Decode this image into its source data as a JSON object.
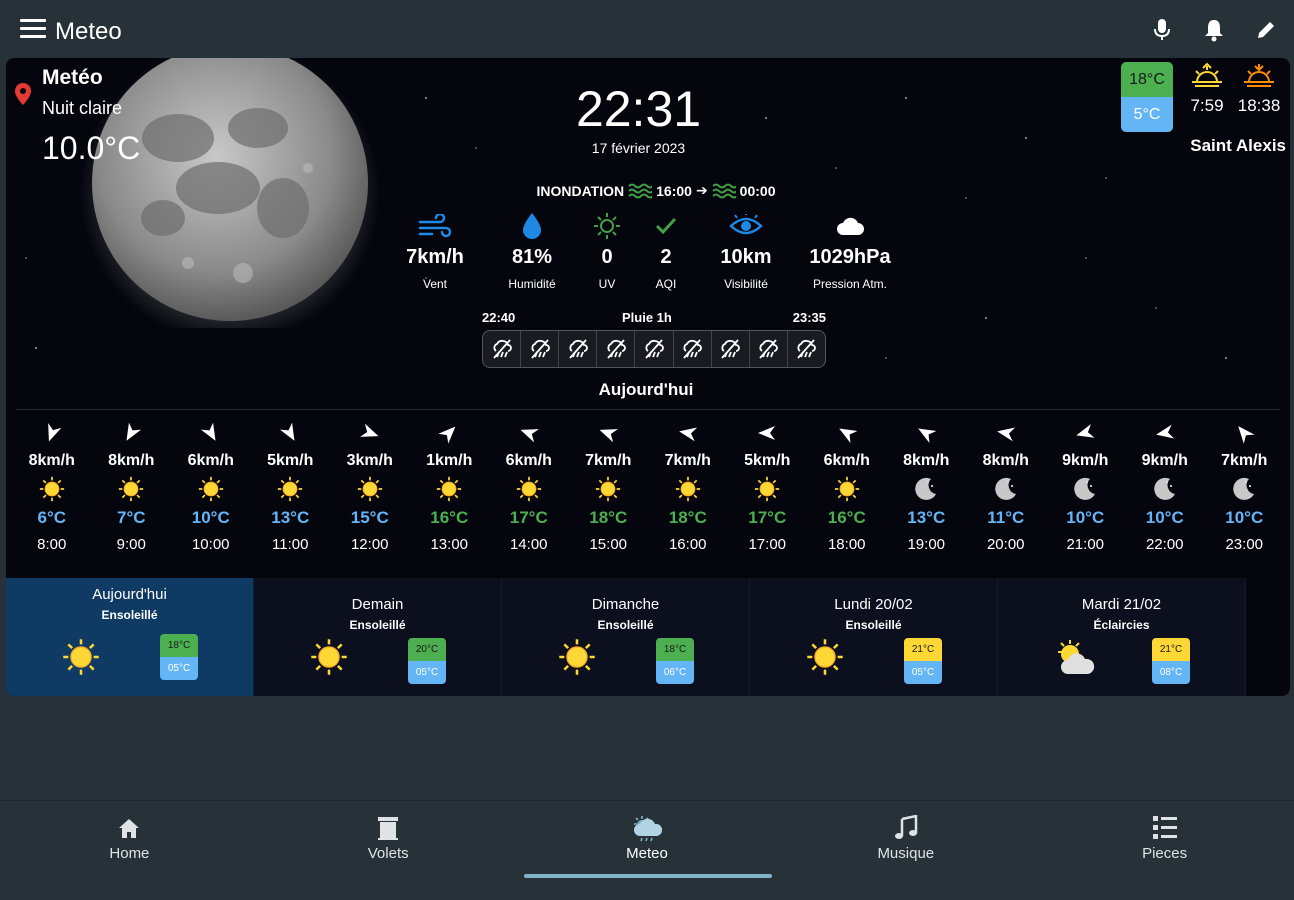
{
  "app": {
    "title": "Meteo"
  },
  "top_actions": [
    "microphone-icon",
    "bell-icon",
    "pencil-icon"
  ],
  "location": {
    "name": "Metéo",
    "condition": "Nuit claire",
    "temperature": "10.0°C",
    "city": "Saint Alexis"
  },
  "clock": {
    "time": "22:31",
    "date": "17 février 2023"
  },
  "alert": {
    "label": "INONDATION",
    "start": "16:00",
    "end": "00:00"
  },
  "metrics": [
    {
      "icon": "wind-icon",
      "value": "7km/h",
      "label": "Vent"
    },
    {
      "icon": "humidity-drop-icon",
      "value": "81%",
      "label": "Humidité"
    },
    {
      "icon": "uv-sun-icon",
      "value": "0",
      "label": "UV"
    },
    {
      "icon": "check-icon",
      "value": "2",
      "label": "AQI"
    },
    {
      "icon": "eye-icon",
      "value": "10km",
      "label": "Visibilité"
    },
    {
      "icon": "cloud-icon",
      "value": "1029hPa",
      "label": "Pression Atm."
    }
  ],
  "rain": {
    "start": "22:40",
    "title": "Pluie 1h",
    "end": "23:35",
    "cells": 9
  },
  "today_label": "Aujourd'hui",
  "today_range": {
    "high": "18°C",
    "low": "5°C"
  },
  "sun": {
    "sunrise": "7:59",
    "sunset": "18:38"
  },
  "colors": {
    "green": "#4caf50",
    "blue": "#64b5f6",
    "yellow": "#fdd835",
    "active_day": "#0f3a63"
  },
  "hourly": [
    {
      "dir": 200,
      "wind": "8km/h",
      "icon": "sun",
      "temp": "6°C",
      "tc": "blue",
      "hour": "8:00"
    },
    {
      "dir": 210,
      "wind": "8km/h",
      "icon": "sun",
      "temp": "7°C",
      "tc": "blue",
      "hour": "9:00"
    },
    {
      "dir": 150,
      "wind": "6km/h",
      "icon": "sun",
      "temp": "10°C",
      "tc": "blue",
      "hour": "10:00"
    },
    {
      "dir": 150,
      "wind": "5km/h",
      "icon": "sun",
      "temp": "13°C",
      "tc": "blue",
      "hour": "11:00"
    },
    {
      "dir": 110,
      "wind": "3km/h",
      "icon": "sun",
      "temp": "15°C",
      "tc": "blue",
      "hour": "12:00"
    },
    {
      "dir": 45,
      "wind": "1km/h",
      "icon": "sun",
      "temp": "16°C",
      "tc": "green",
      "hour": "13:00"
    },
    {
      "dir": 290,
      "wind": "6km/h",
      "icon": "sun",
      "temp": "17°C",
      "tc": "green",
      "hour": "14:00"
    },
    {
      "dir": 290,
      "wind": "7km/h",
      "icon": "sun",
      "temp": "18°C",
      "tc": "green",
      "hour": "15:00"
    },
    {
      "dir": 280,
      "wind": "7km/h",
      "icon": "sun",
      "temp": "18°C",
      "tc": "green",
      "hour": "16:00"
    },
    {
      "dir": 270,
      "wind": "5km/h",
      "icon": "sun",
      "temp": "17°C",
      "tc": "green",
      "hour": "17:00"
    },
    {
      "dir": 300,
      "wind": "6km/h",
      "icon": "sun",
      "temp": "16°C",
      "tc": "green",
      "hour": "18:00"
    },
    {
      "dir": 300,
      "wind": "8km/h",
      "icon": "moon",
      "temp": "13°C",
      "tc": "blue",
      "hour": "19:00"
    },
    {
      "dir": 280,
      "wind": "8km/h",
      "icon": "moon",
      "temp": "11°C",
      "tc": "blue",
      "hour": "20:00"
    },
    {
      "dir": 255,
      "wind": "9km/h",
      "icon": "moon",
      "temp": "10°C",
      "tc": "blue",
      "hour": "21:00"
    },
    {
      "dir": 260,
      "wind": "9km/h",
      "icon": "moon",
      "temp": "10°C",
      "tc": "blue",
      "hour": "22:00"
    },
    {
      "dir": 320,
      "wind": "7km/h",
      "icon": "moon",
      "temp": "10°C",
      "tc": "blue",
      "hour": "23:00"
    }
  ],
  "daily": [
    {
      "name": "Aujourd'hui",
      "condition": "Ensoleillé",
      "icon": "sun",
      "high": "18°C",
      "low": "05°C",
      "hc": "green",
      "active": true
    },
    {
      "name": "Demain",
      "condition": "Ensoleillé",
      "icon": "sun",
      "high": "20°C",
      "low": "05°C",
      "hc": "green",
      "active": false
    },
    {
      "name": "Dimanche",
      "condition": "Ensoleillé",
      "icon": "sun",
      "high": "18°C",
      "low": "06°C",
      "hc": "green",
      "active": false
    },
    {
      "name": "Lundi 20/02",
      "condition": "Ensoleillé",
      "icon": "sun",
      "high": "21°C",
      "low": "05°C",
      "hc": "yellow",
      "active": false
    },
    {
      "name": "Mardi 21/02",
      "condition": "Éclaircies",
      "icon": "partly-cloudy",
      "high": "21°C",
      "low": "08°C",
      "hc": "yellow",
      "active": false
    }
  ],
  "nav": [
    {
      "label": "Home",
      "icon": "home-icon",
      "active": false
    },
    {
      "label": "Volets",
      "icon": "shutter-icon",
      "active": false
    },
    {
      "label": "Meteo",
      "icon": "weather-icon",
      "active": true
    },
    {
      "label": "Musique",
      "icon": "music-icon",
      "active": false
    },
    {
      "label": "Pieces",
      "icon": "list-icon",
      "active": false
    }
  ]
}
